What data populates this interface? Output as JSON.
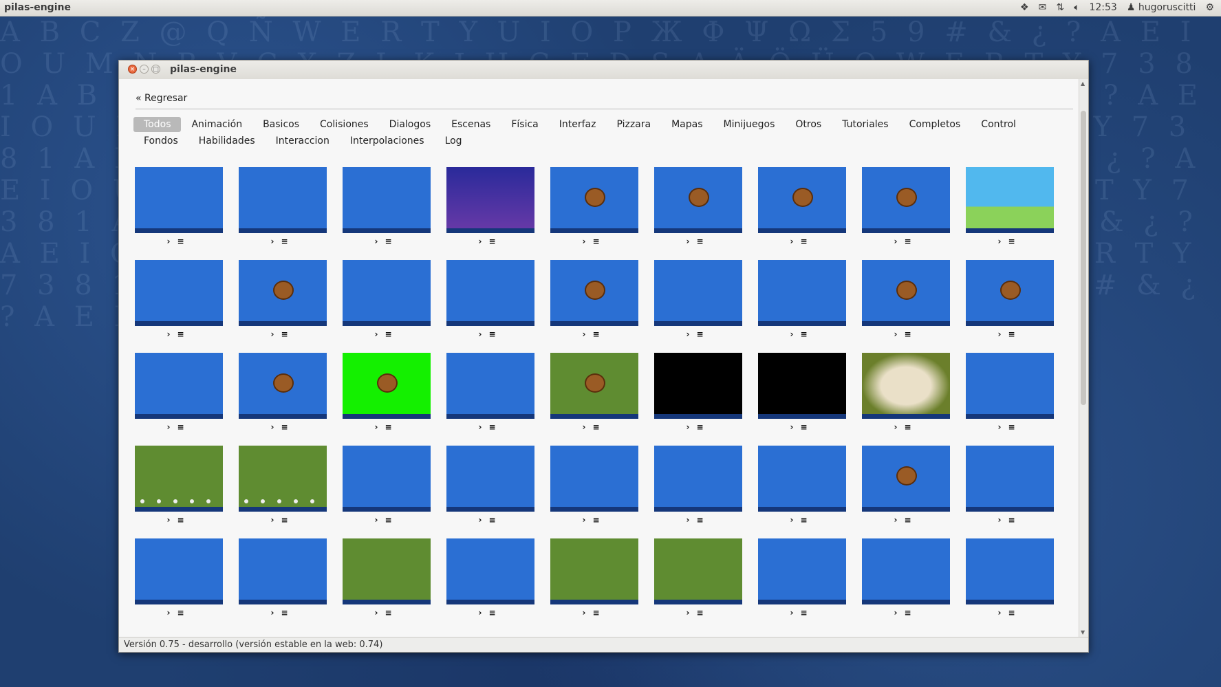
{
  "top_panel": {
    "title": "pilas-engine",
    "clock": "12:53",
    "user": "hugoruscitti",
    "icons": [
      "dropbox-icon",
      "mail-icon",
      "network-icon",
      "volume-icon",
      "user-icon",
      "gear-icon"
    ]
  },
  "window": {
    "title": "pilas-engine",
    "back_label": "« Regresar",
    "categories": [
      "Todos",
      "Animación",
      "Basicos",
      "Colisiones",
      "Dialogos",
      "Escenas",
      "Física",
      "Interfaz",
      "Pizzara",
      "Mapas",
      "Minijuegos",
      "Otros",
      "Tutoriales",
      "Completos",
      "Control",
      "Fondos",
      "Habilidades",
      "Interaccion",
      "Interpolaciones",
      "Log"
    ],
    "active_category": "Todos",
    "status": "Versión 0.75 - desarrollo (versión estable en la web: 0.74)",
    "tile_action_icons": [
      "run-arrow-icon",
      "source-lines-icon"
    ],
    "tile_action_labels": {
      "run": "›",
      "source": "≡"
    },
    "tile_themes": [
      "blue",
      "blue",
      "blue",
      "night",
      "blue",
      "blue",
      "blue",
      "blue",
      "sky",
      "blue",
      "blue",
      "blue",
      "blue",
      "blue",
      "blue",
      "blue",
      "blue",
      "blue",
      "blue",
      "blue",
      "lime",
      "blue",
      "green",
      "black",
      "black",
      "jungle",
      "blue",
      "green",
      "green",
      "blue",
      "blue",
      "blue",
      "blue",
      "blue",
      "blue",
      "blue",
      "blue",
      "blue",
      "green",
      "blue",
      "green",
      "green",
      "blue",
      "blue",
      "blue"
    ]
  },
  "colors": {
    "accent_blue": "#2b6fd3",
    "active_tab": "#b9b9b9",
    "close_button": "#dd4b1c"
  }
}
